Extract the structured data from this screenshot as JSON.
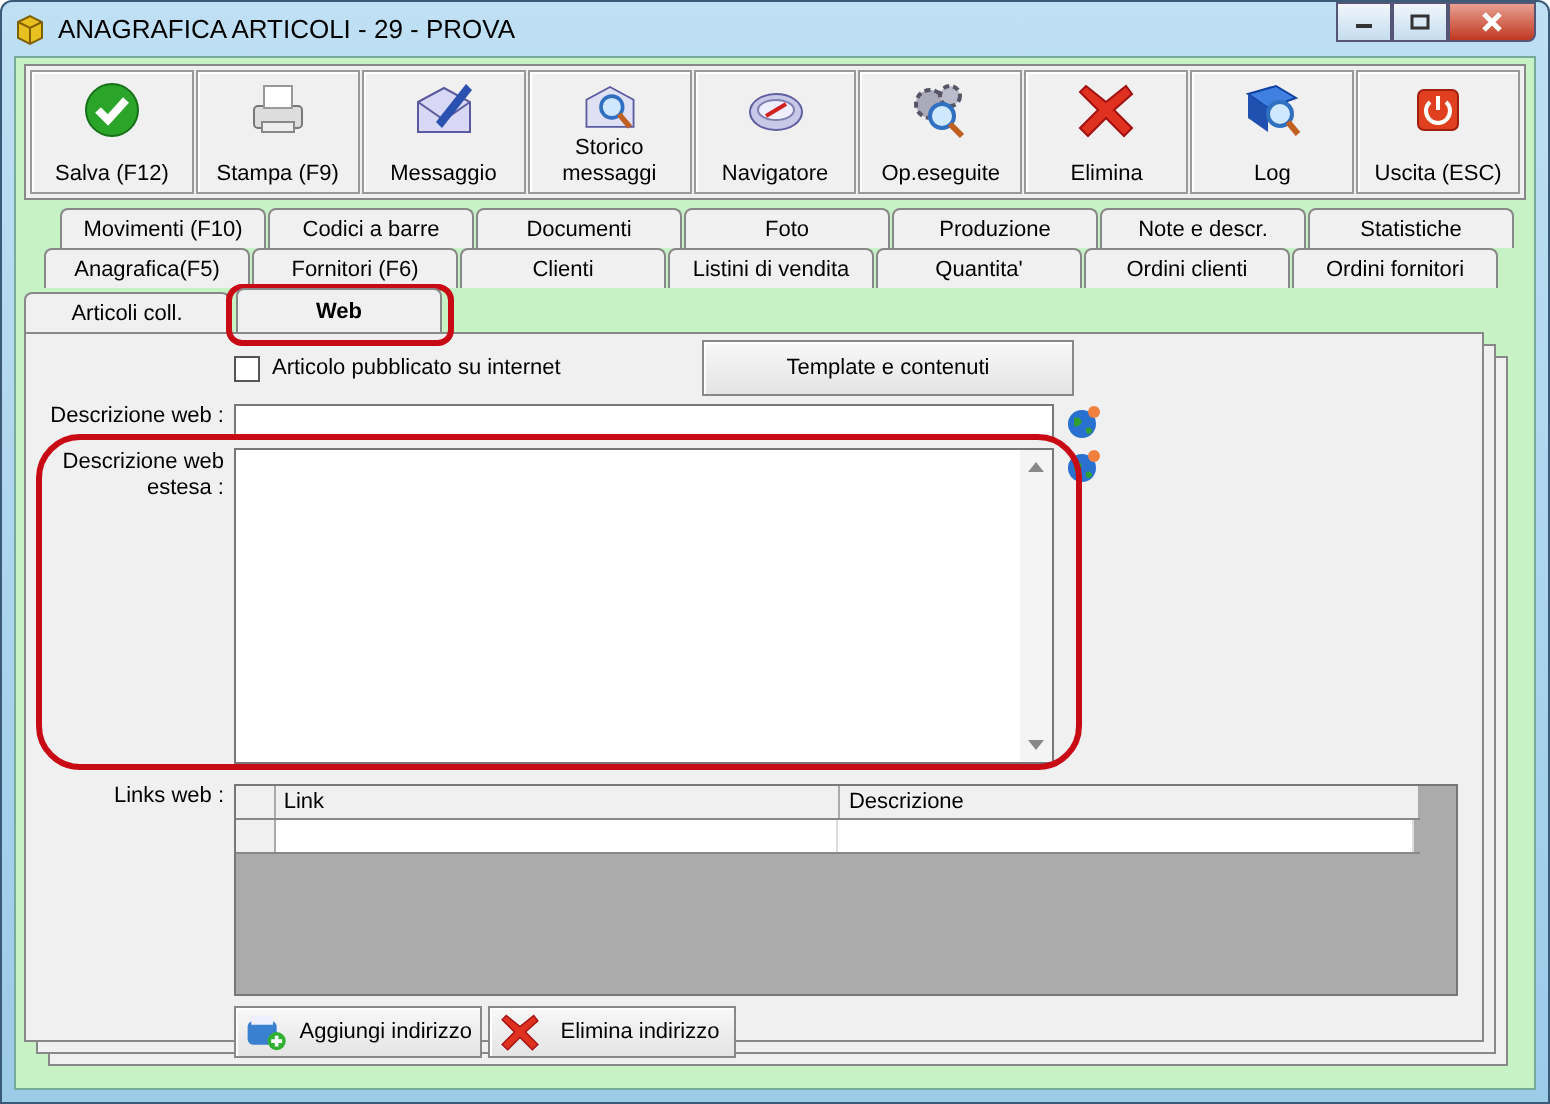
{
  "window": {
    "title": "ANAGRAFICA ARTICOLI - 29 - PROVA"
  },
  "toolbar": [
    {
      "label": "Salva (F12)",
      "kind": "check"
    },
    {
      "label": "Stampa (F9)",
      "kind": "printer"
    },
    {
      "label": "Messaggio",
      "kind": "pen"
    },
    {
      "label": "Storico messaggi",
      "kind": "mailsearch"
    },
    {
      "label": "Navigatore",
      "kind": "compass"
    },
    {
      "label": "Op.eseguite",
      "kind": "gears"
    },
    {
      "label": "Elimina",
      "kind": "cross"
    },
    {
      "label": "Log",
      "kind": "book"
    },
    {
      "label": "Uscita (ESC)",
      "kind": "power"
    }
  ],
  "tab_rows": [
    [
      {
        "label": "Movimenti (F10)",
        "selected": false
      },
      {
        "label": "Codici a barre",
        "selected": false
      },
      {
        "label": "Documenti",
        "selected": false
      },
      {
        "label": "Foto",
        "selected": false
      },
      {
        "label": "Produzione",
        "selected": false
      },
      {
        "label": "Note e descr.",
        "selected": false
      },
      {
        "label": "Statistiche",
        "selected": false
      }
    ],
    [
      {
        "label": "Anagrafica(F5)",
        "selected": false
      },
      {
        "label": "Fornitori (F6)",
        "selected": false
      },
      {
        "label": "Clienti",
        "selected": false
      },
      {
        "label": "Listini di vendita",
        "selected": false
      },
      {
        "label": "Quantita'",
        "selected": false
      },
      {
        "label": "Ordini clienti",
        "selected": false
      },
      {
        "label": "Ordini fornitori",
        "selected": false
      }
    ],
    [
      {
        "label": "Articoli coll.",
        "selected": false
      },
      {
        "label": "Web",
        "selected": true
      }
    ]
  ],
  "published": {
    "label": "Articolo pubblicato su internet",
    "checked": false
  },
  "template_button": "Template e contenuti",
  "web_description": {
    "label": "Descrizione web :"
  },
  "extended_description": {
    "label": "Descrizione web estesa :"
  },
  "links": {
    "label": "Links web :",
    "columns": [
      "Link",
      "Descrizione"
    ]
  },
  "actions": [
    {
      "label": "Aggiungi indirizzo",
      "kind": "add"
    },
    {
      "label": "Elimina indirizzo",
      "kind": "cross"
    }
  ]
}
